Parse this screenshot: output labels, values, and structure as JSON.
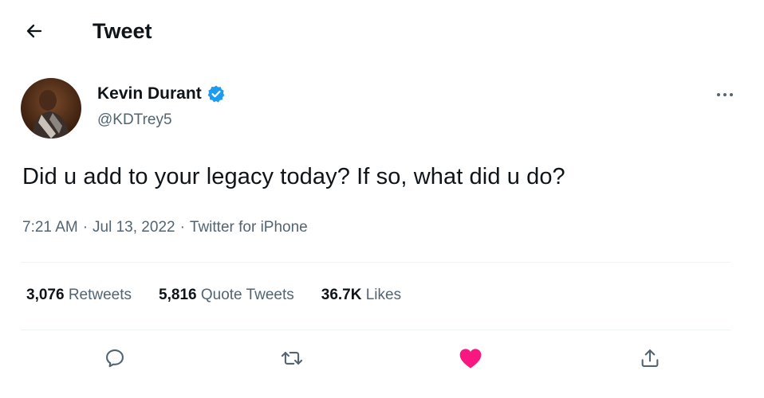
{
  "header": {
    "title": "Tweet"
  },
  "author": {
    "name": "Kevin Durant",
    "handle": "@KDTrey5",
    "verified": true
  },
  "tweet": {
    "text": "Did u add to your legacy today? If so, what did u do?",
    "time": "7:21 AM",
    "date": "Jul 13, 2022",
    "source": "Twitter for iPhone",
    "separator": "·"
  },
  "stats": {
    "retweets_count": "3,076",
    "retweets_label": "Retweets",
    "quotes_count": "5,816",
    "quotes_label": "Quote Tweets",
    "likes_count": "36.7K",
    "likes_label": "Likes"
  },
  "colors": {
    "verified_blue": "#1d9bf0",
    "like_pink": "#f91880",
    "secondary_text": "#536471",
    "primary_text": "#0f1419"
  },
  "icons": {
    "back": "arrow-left-icon",
    "more": "more-icon",
    "reply": "reply-icon",
    "retweet": "retweet-icon",
    "like": "heart-icon",
    "share": "share-icon",
    "verified": "verified-badge-icon"
  }
}
